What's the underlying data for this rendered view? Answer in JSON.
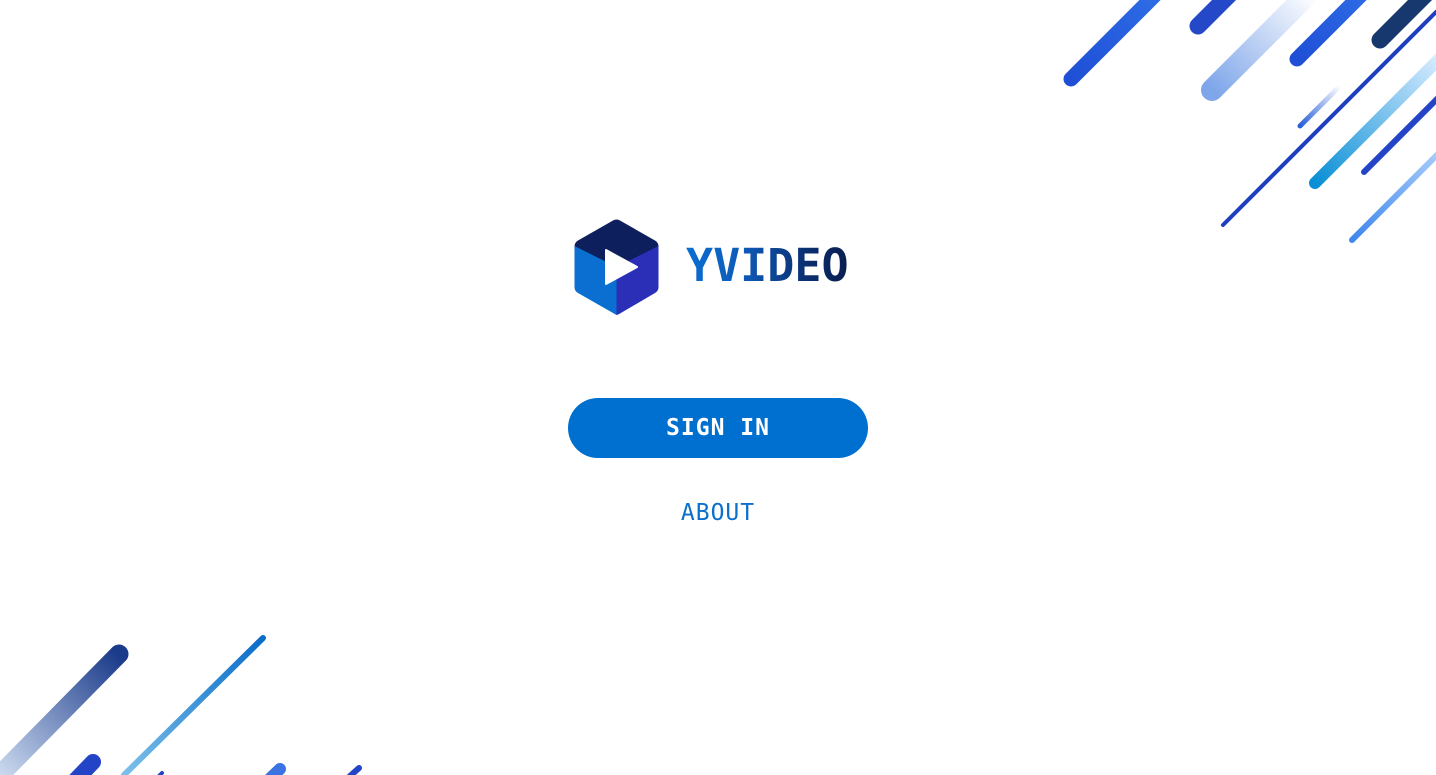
{
  "brand": {
    "name": "YVIDEO",
    "logo_icon": "play-hexagon-icon",
    "colors": {
      "hex_top": "#0d1f5c",
      "hex_left": "#0a6fd0",
      "hex_right": "#2b2fb8",
      "play": "#ffffff"
    }
  },
  "actions": {
    "sign_in_label": "SIGN IN",
    "about_label": "ABOUT"
  },
  "theme": {
    "primary": "#0070d0",
    "background": "#ffffff"
  }
}
